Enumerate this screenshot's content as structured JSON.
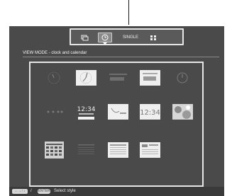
{
  "toolbar": {
    "single_label": "SINGLE",
    "modes": [
      {
        "name": "slideshow",
        "icon": "slideshow-icon"
      },
      {
        "name": "clock",
        "icon": "clock-icon",
        "selected": true
      },
      {
        "name": "single",
        "icon": null
      },
      {
        "name": "index",
        "icon": "index-icon"
      }
    ]
  },
  "header": {
    "mode_title": "VIEW MODE - clock and calendar"
  },
  "styles": {
    "rows": 3,
    "cols": 5,
    "items": [
      {
        "id": "s1",
        "kind": "analog-dark"
      },
      {
        "id": "s2",
        "kind": "analog-light"
      },
      {
        "id": "s3",
        "kind": "digital-dark"
      },
      {
        "id": "s4",
        "kind": "digital-light"
      },
      {
        "id": "s5",
        "kind": "round-dark"
      },
      {
        "id": "s6",
        "kind": "dots-dark"
      },
      {
        "id": "s7",
        "kind": "digital-big-dark",
        "text": "12:34"
      },
      {
        "id": "s8",
        "kind": "analog-white"
      },
      {
        "id": "s9",
        "kind": "digital-white",
        "text": "12:34"
      },
      {
        "id": "s10",
        "kind": "photo"
      },
      {
        "id": "s11",
        "kind": "calendar-dark"
      },
      {
        "id": "s12",
        "kind": "calendar-dark2"
      },
      {
        "id": "s13",
        "kind": "calendar-white"
      },
      {
        "id": "s14",
        "kind": "calendar-photo"
      }
    ]
  },
  "bottom_bar": {
    "nav_key": "←→↑↓",
    "slash": "/",
    "enter_key": "ENTER",
    "hint": "Select style"
  },
  "colors": {
    "screen_bg": "#4a4a4a",
    "border": "#e6e6e6",
    "text": "#f4f4f4"
  }
}
